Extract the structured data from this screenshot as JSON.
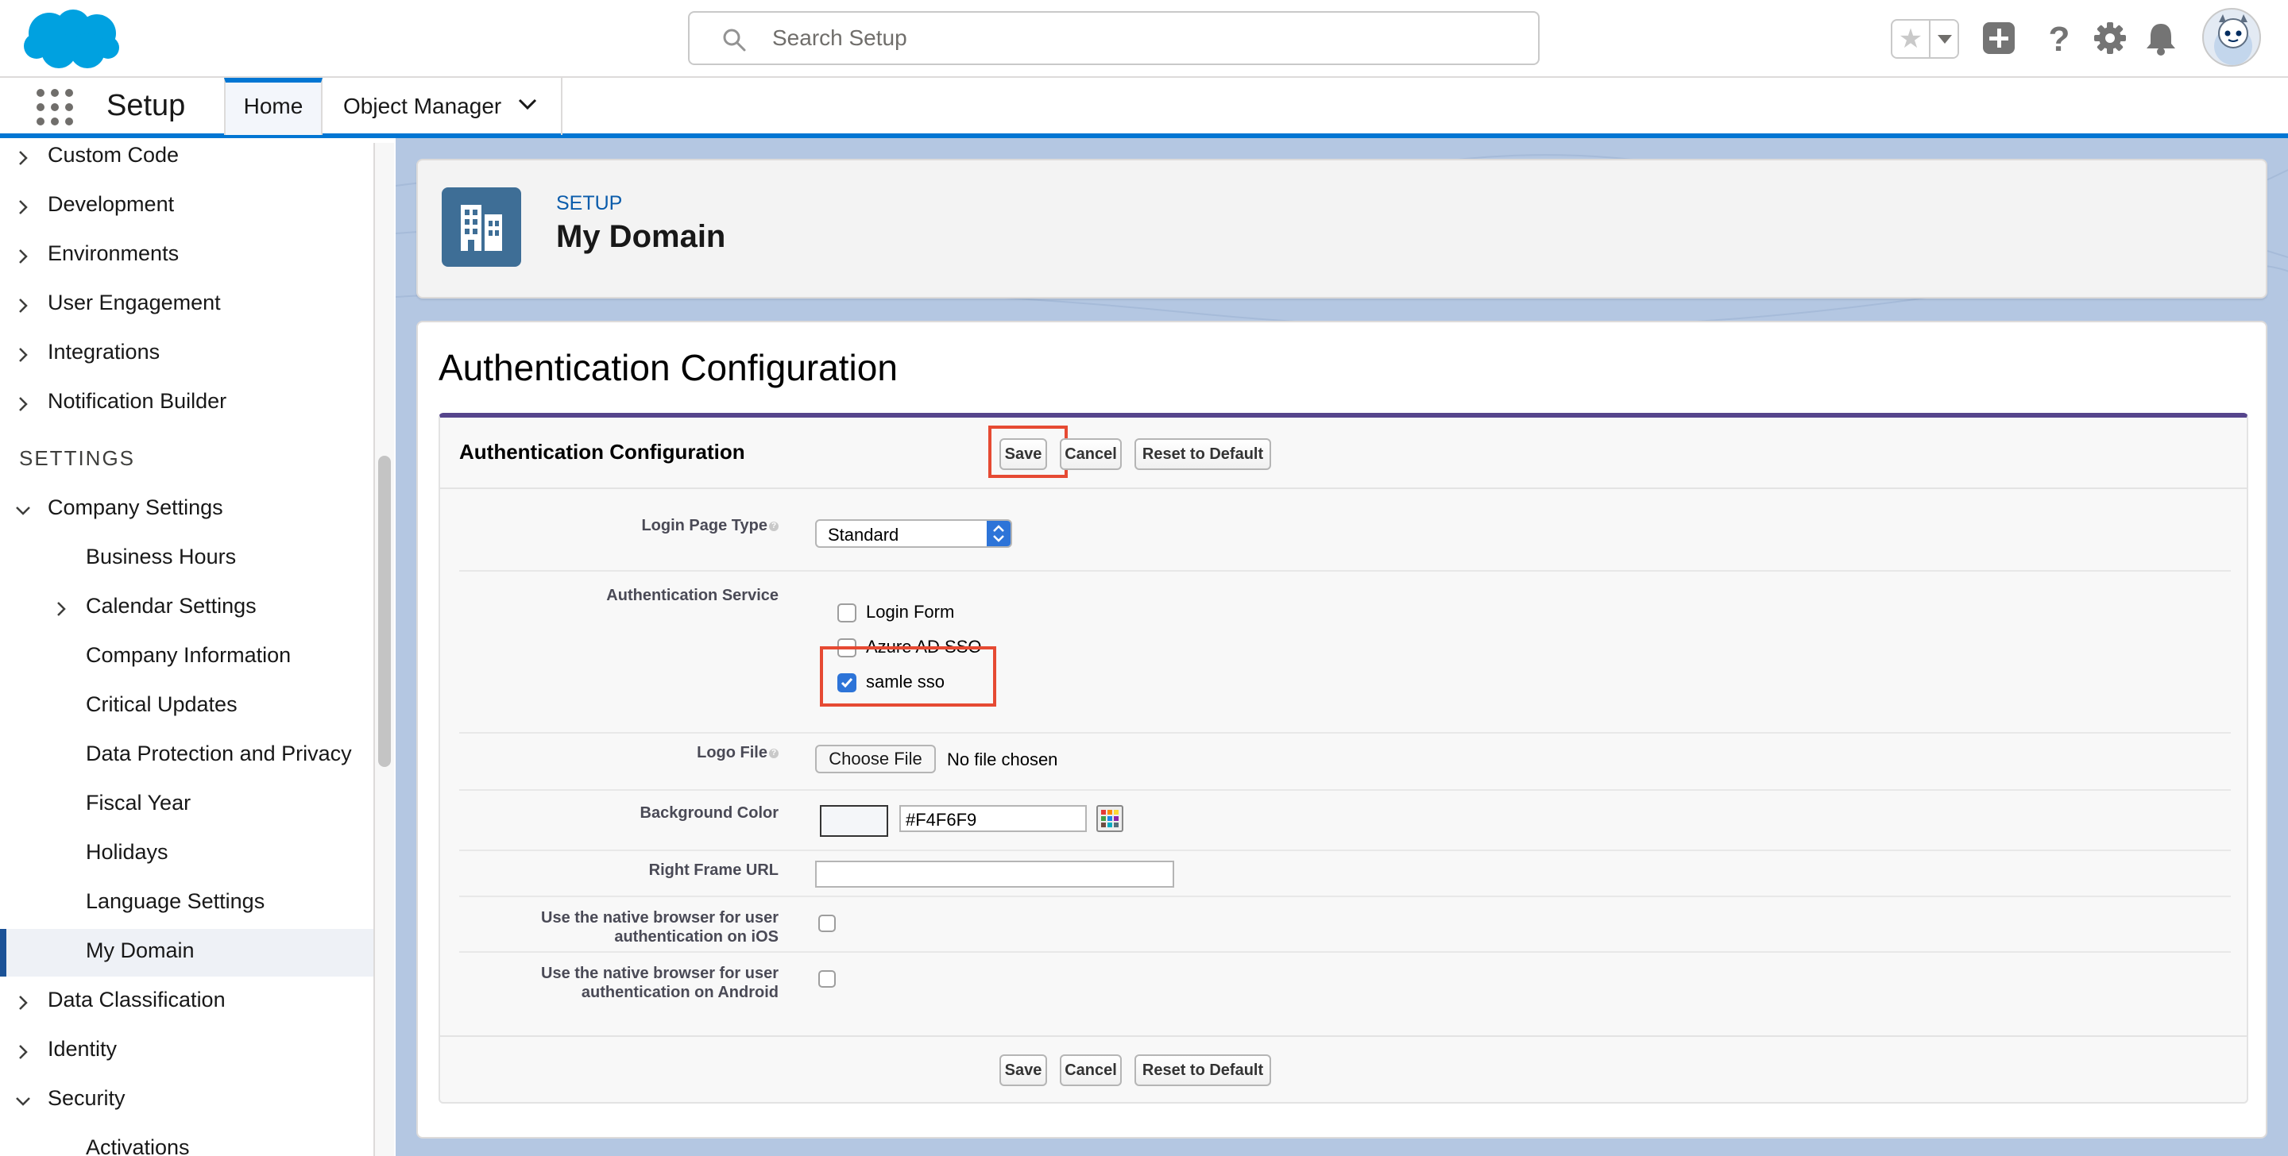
{
  "header": {
    "search_placeholder": "Search Setup",
    "icons": [
      "salesforce-logo",
      "favorites-star-icon",
      "favorites-dropdown-icon",
      "global-actions-icon",
      "help-icon",
      "setup-gear-icon",
      "notifications-bell-icon",
      "user-avatar"
    ]
  },
  "nav": {
    "app_name": "Setup",
    "tabs": [
      {
        "label": "Home"
      },
      {
        "label": "Object Manager"
      }
    ]
  },
  "sidebar": {
    "top_items": [
      {
        "label": "Custom Code",
        "expandable": true
      },
      {
        "label": "Development",
        "expandable": true
      },
      {
        "label": "Environments",
        "expandable": true
      },
      {
        "label": "User Engagement",
        "expandable": true
      },
      {
        "label": "Integrations",
        "expandable": true
      },
      {
        "label": "Notification Builder",
        "expandable": true
      }
    ],
    "section_header": "SETTINGS",
    "company_settings": {
      "label": "Company Settings",
      "children": [
        {
          "label": "Business Hours"
        },
        {
          "label": "Calendar Settings",
          "expandable": true
        },
        {
          "label": "Company Information"
        },
        {
          "label": "Critical Updates"
        },
        {
          "label": "Data Protection and Privacy"
        },
        {
          "label": "Fiscal Year"
        },
        {
          "label": "Holidays"
        },
        {
          "label": "Language Settings"
        },
        {
          "label": "My Domain",
          "active": true
        }
      ]
    },
    "bottom_items": [
      {
        "label": "Data Classification",
        "expandable": true
      },
      {
        "label": "Identity",
        "expandable": true
      },
      {
        "label": "Security",
        "expanded": true
      },
      {
        "label": "Activations"
      }
    ]
  },
  "page_header": {
    "eyebrow": "SETUP",
    "title": "My Domain"
  },
  "main": {
    "heading": "Authentication Configuration",
    "block_title": "Authentication Configuration",
    "buttons": {
      "save": "Save",
      "cancel": "Cancel",
      "reset": "Reset to Default"
    },
    "fields": {
      "login_page_type": {
        "label": "Login Page Type",
        "value": "Standard"
      },
      "authentication_service": {
        "label": "Authentication Service",
        "options": [
          {
            "label": "Login Form",
            "checked": false
          },
          {
            "label": "Azure AD SSO",
            "checked": false
          },
          {
            "label": "samle sso",
            "checked": true
          }
        ]
      },
      "logo_file": {
        "label": "Logo File",
        "button": "Choose File",
        "status": "No file chosen"
      },
      "background_color": {
        "label": "Background Color",
        "value": "#F4F6F9"
      },
      "right_frame_url": {
        "label": "Right Frame URL",
        "value": ""
      },
      "native_ios": {
        "label_line1": "Use the native browser for user",
        "label_line2": "authentication on iOS",
        "checked": false
      },
      "native_android": {
        "label_line1": "Use the native browser for user",
        "label_line2": "authentication on Android",
        "checked": false
      }
    }
  },
  "colors": {
    "brand_blue": "#0176d3",
    "highlight_red": "#e64a33",
    "page_header_icon": "#3e6e96",
    "block_top_border": "#56458c"
  }
}
